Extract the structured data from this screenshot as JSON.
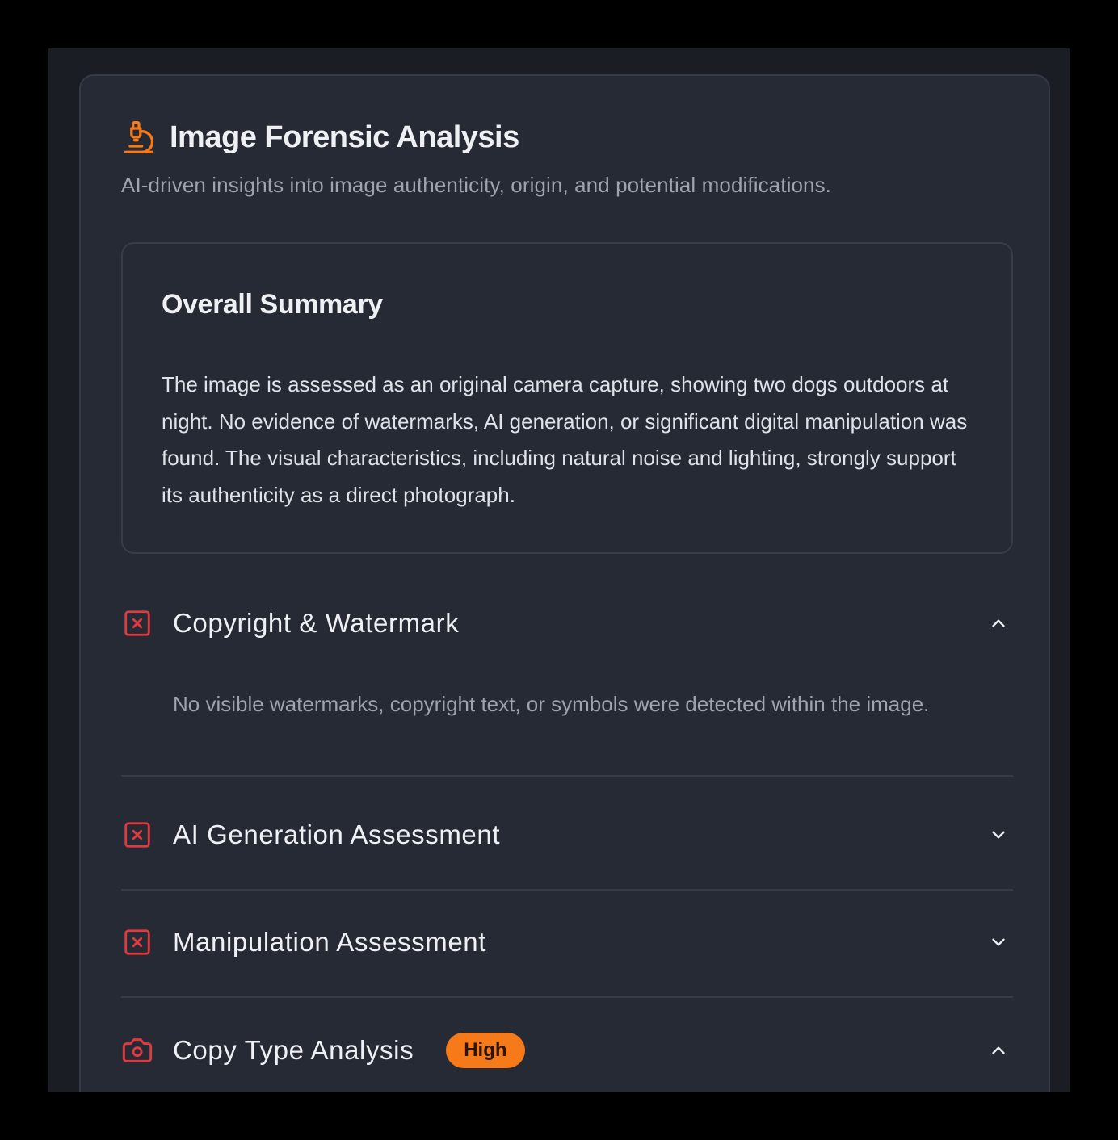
{
  "header": {
    "title": "Image Forensic Analysis",
    "subtitle": "AI-driven insights into image authenticity, origin, and potential modifications.",
    "icon": "microscope-icon"
  },
  "summary": {
    "title": "Overall Summary",
    "body": "The image is assessed as an original camera capture, showing two dogs outdoors at night. No evidence of watermarks, AI generation, or significant digital manipulation was found. The visual characteristics, including natural noise and lighting, strongly support its authenticity as a direct photograph."
  },
  "sections": [
    {
      "title": "Copyright & Watermark",
      "icon": "x-square-icon",
      "expanded": true,
      "body": "No visible watermarks, copyright text, or symbols were detected within the image."
    },
    {
      "title": "AI Generation Assessment",
      "icon": "x-square-icon",
      "expanded": false
    },
    {
      "title": "Manipulation Assessment",
      "icon": "x-square-icon",
      "expanded": false
    },
    {
      "title": "Copy Type Analysis",
      "icon": "camera-icon",
      "expanded": true,
      "badge": "High"
    }
  ],
  "colors": {
    "accent": "#f77a1a",
    "danger": "#e0393e",
    "background": "#262a35"
  }
}
